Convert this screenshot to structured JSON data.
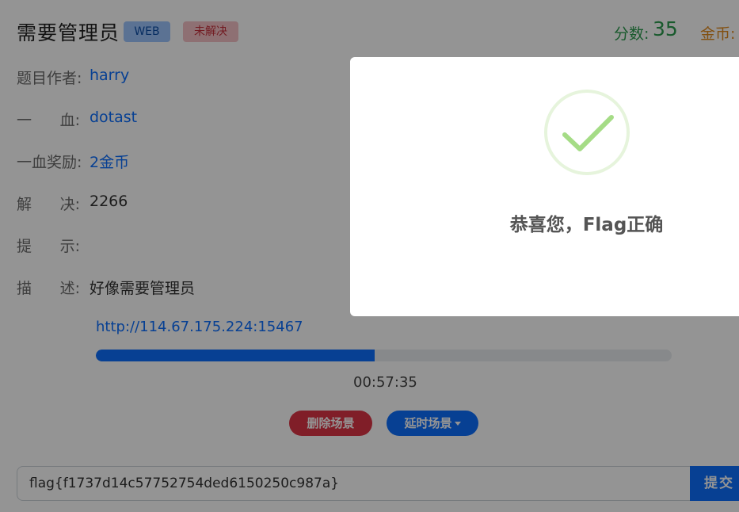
{
  "challenge": {
    "title": "需要管理员",
    "category_badge": "WEB",
    "status_badge": "未解决"
  },
  "stats": {
    "score_label": "分数:",
    "score_value": "35",
    "coin_label": "金币:"
  },
  "details": {
    "author_label": "题目作者:",
    "author": "harry",
    "blood_label_1": "一",
    "blood_label_2": "血:",
    "first_blood": "dotast",
    "reward_label": "一血奖励:",
    "reward": "2金币",
    "solves_label_1": "解",
    "solves_label_2": "决:",
    "solves": "2266",
    "hint_label_1": "提",
    "hint_label_2": "示:",
    "hint": "",
    "desc_label_1": "描",
    "desc_label_2": "述:",
    "description": "好像需要管理员"
  },
  "instance": {
    "url": "http://114.67.175.224:15467",
    "progress_percent": 48.4,
    "timer": "00:57:35",
    "delete_label": "删除场景",
    "delay_label": "延时场景"
  },
  "submit": {
    "flag_value": "flag{f1737d14c57752754ded6150250c987a}",
    "submit_label": "提交"
  },
  "modal": {
    "title": "恭喜您，Flag正确",
    "icon": "success-check-icon",
    "accent_color": "#a5dc86"
  }
}
